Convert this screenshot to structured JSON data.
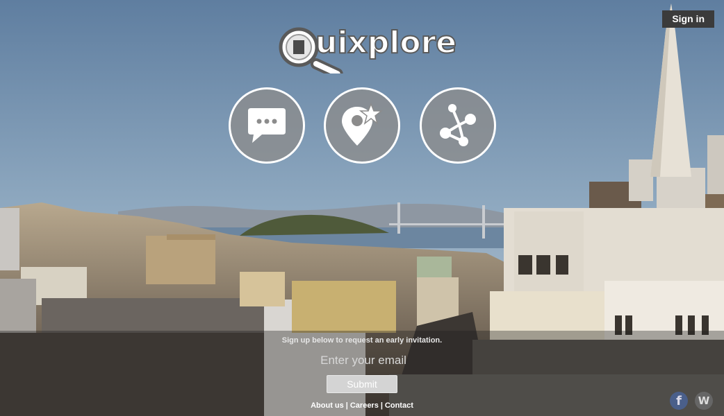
{
  "header": {
    "signin_label": "Sign in"
  },
  "logo": {
    "text": "uixplore",
    "icon": "magnifier-q-icon"
  },
  "features": [
    {
      "icon": "chat-bubble-icon"
    },
    {
      "icon": "location-star-icon"
    },
    {
      "icon": "network-share-icon"
    }
  ],
  "signup": {
    "message": "Sign up below to request an early invitation.",
    "email_placeholder": "Enter your email",
    "submit_label": "Submit"
  },
  "footer": {
    "links": [
      "About us",
      "Careers",
      "Contact"
    ],
    "separator": "|"
  },
  "social": {
    "facebook_label": "f",
    "wordpress_label": "W"
  },
  "colors": {
    "sky": "#8aa9c6",
    "overlay": "#1e1e1e",
    "signin_bg": "#3b3b3b"
  }
}
